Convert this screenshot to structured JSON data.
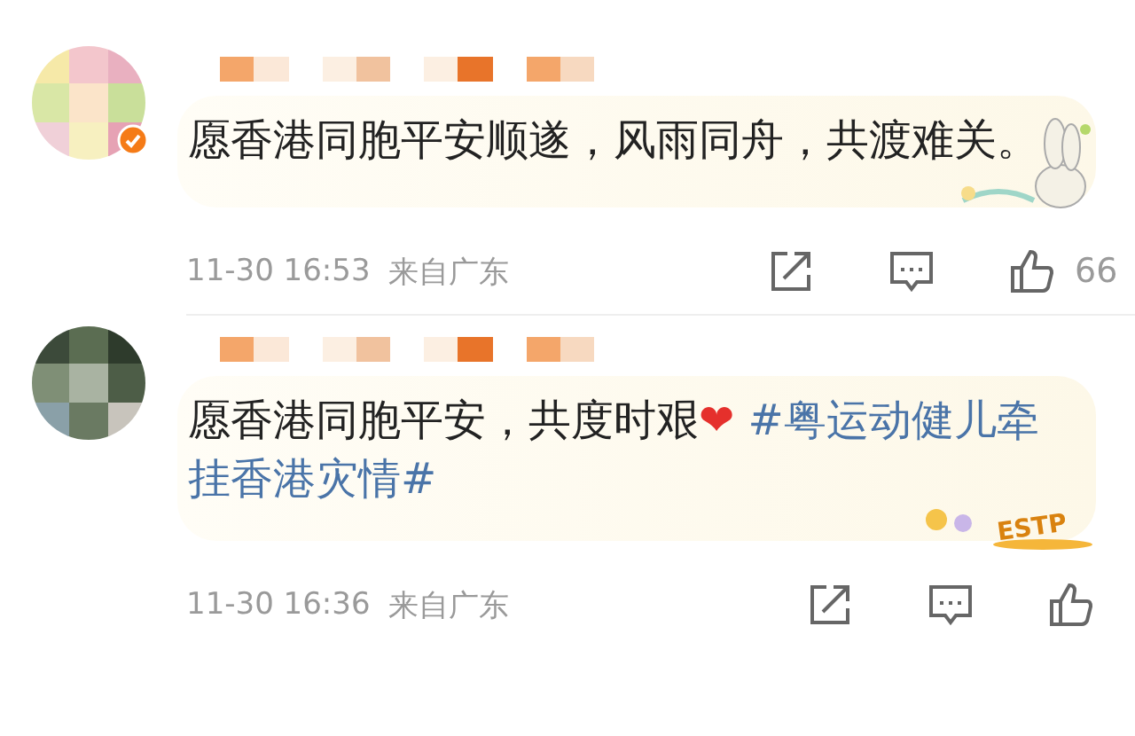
{
  "comments": [
    {
      "avatar": {
        "kind": "pastel",
        "verified": true
      },
      "body": [
        {
          "kind": "text",
          "text": "愿香港同胞平安顺遂，风雨同舟，共渡难关。"
        }
      ],
      "decoration": {
        "kind": "bunny"
      },
      "time": "11-30 16:53",
      "location": "来自广东",
      "likes": "66"
    },
    {
      "avatar": {
        "kind": "dark",
        "verified": false
      },
      "body": [
        {
          "kind": "text",
          "text": "愿香港同胞平安，共度时艰"
        },
        {
          "kind": "emoji",
          "text": "❤"
        },
        {
          "kind": "hashtag",
          "text": " #粤运动健儿牵挂香港灾情#"
        }
      ],
      "decoration": {
        "kind": "sticker",
        "label": "ESTP"
      },
      "time": "11-30 16:36",
      "location": "来自广东"
    }
  ]
}
